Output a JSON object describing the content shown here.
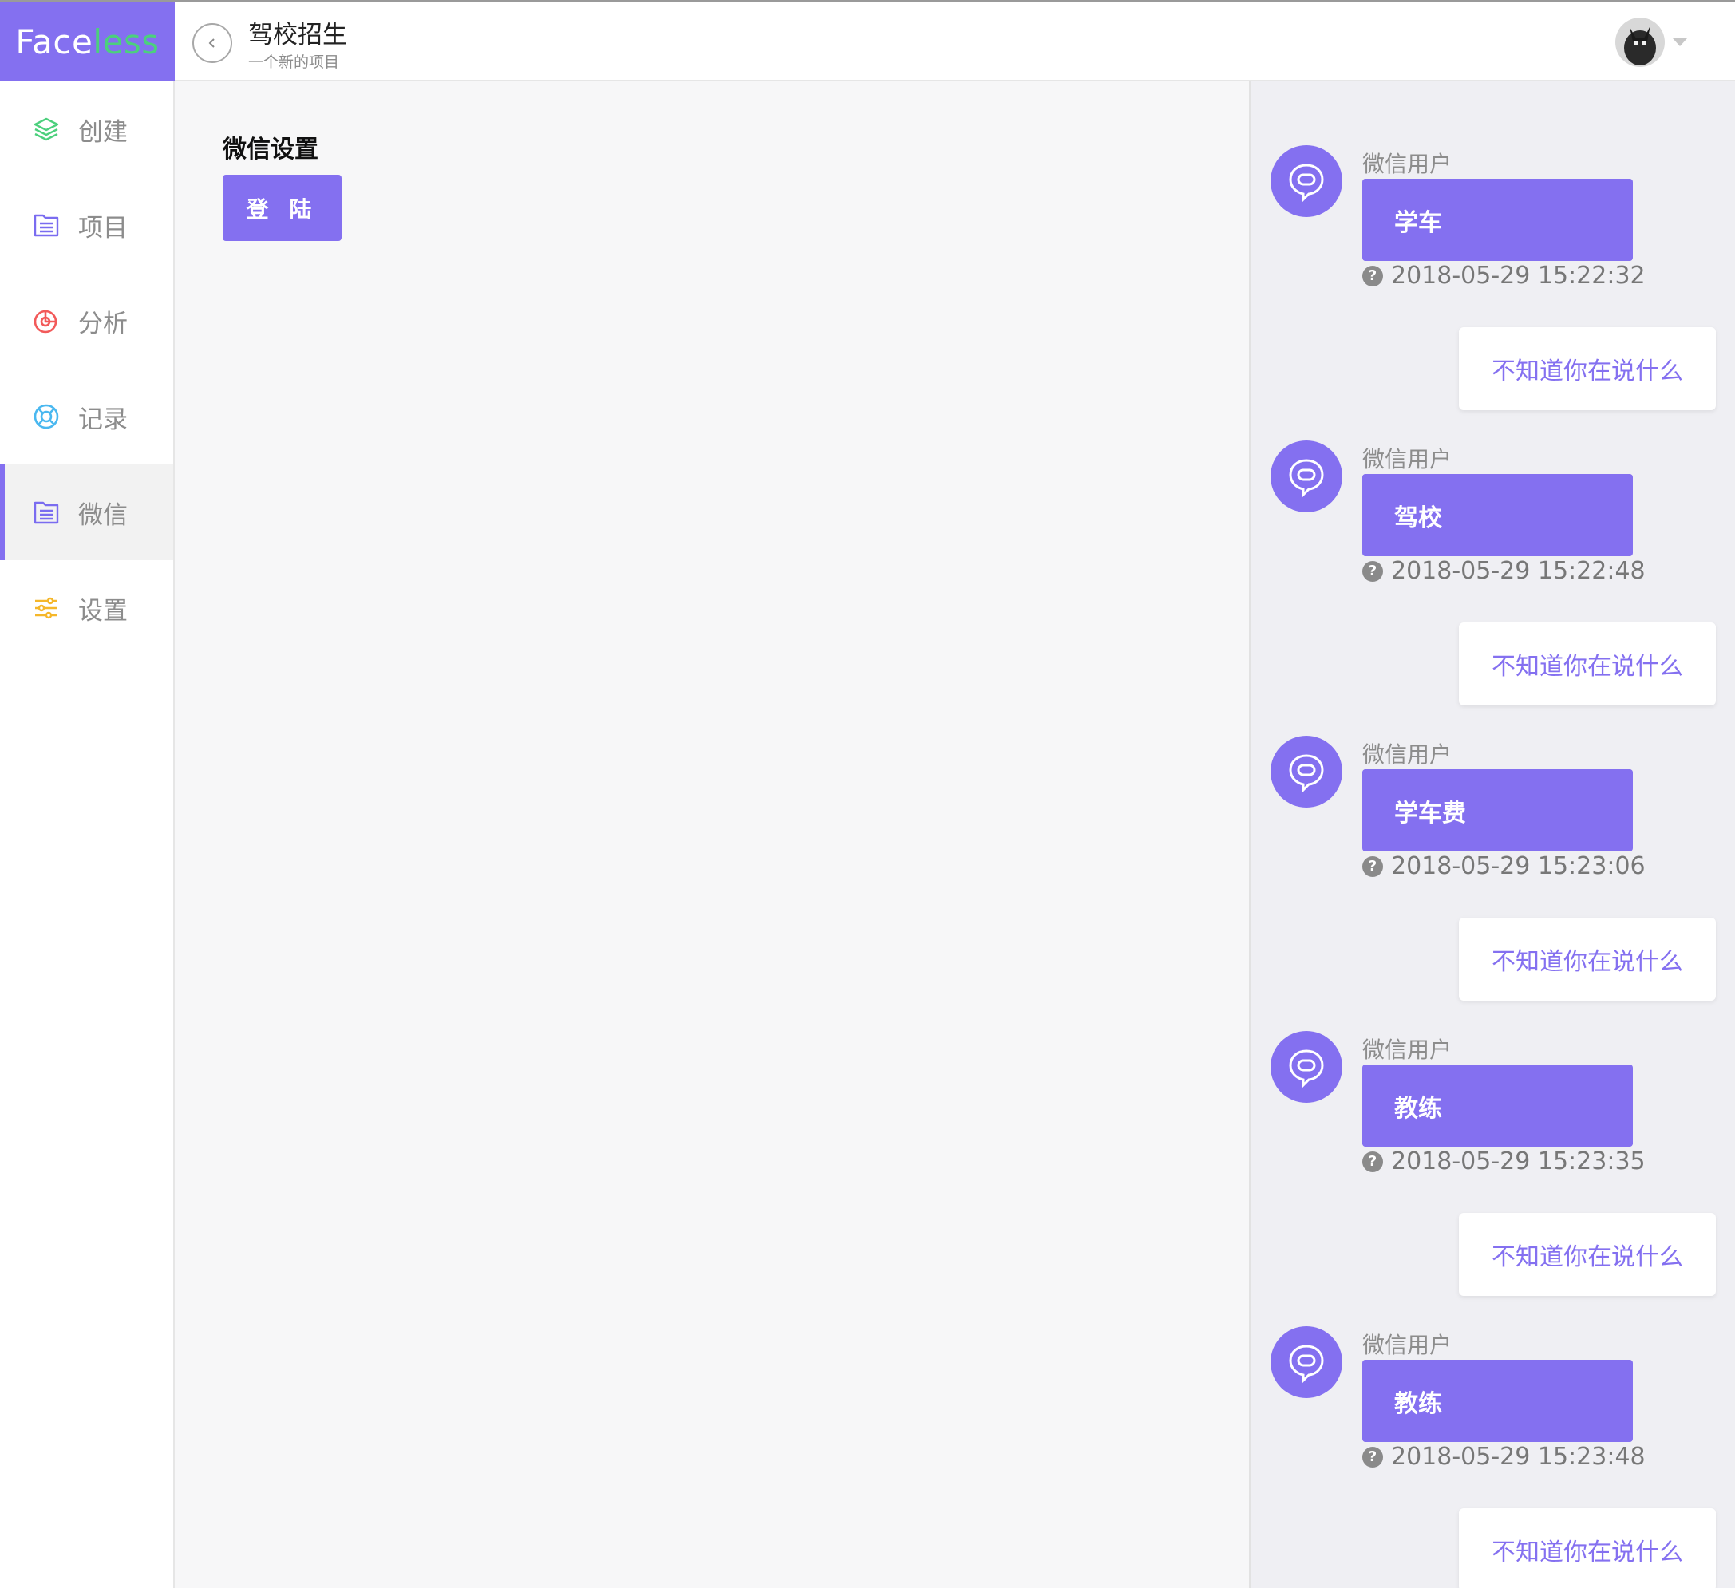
{
  "brand": {
    "prefix": "Face",
    "suffix": "less",
    "accent_color": "#4cd07d",
    "brand_color": "#8470f0"
  },
  "header": {
    "back_icon": "chevron-left-icon",
    "title": "驾校招生",
    "subtitle": "一个新的项目"
  },
  "sidebar": {
    "items": [
      {
        "label": "创建",
        "icon": "layers-icon",
        "color": "#4cd07d",
        "active": false
      },
      {
        "label": "项目",
        "icon": "list-folder-icon",
        "color": "#7a6cf0",
        "active": false
      },
      {
        "label": "分析",
        "icon": "pie-chart-icon",
        "color": "#f25a5a",
        "active": false
      },
      {
        "label": "记录",
        "icon": "lifebuoy-icon",
        "color": "#4ab8f0",
        "active": false
      },
      {
        "label": "微信",
        "icon": "list-folder-icon",
        "color": "#7a6cf0",
        "active": true
      },
      {
        "label": "设置",
        "icon": "sliders-icon",
        "color": "#f5b72a",
        "active": false
      }
    ]
  },
  "main": {
    "section_title": "微信设置",
    "login_button": "登 陆"
  },
  "chat": {
    "messages": [
      {
        "sender": "微信用户",
        "text": "学车",
        "time": "2018-05-29 15:22:32",
        "reply": "不知道你在说什么"
      },
      {
        "sender": "微信用户",
        "text": "驾校",
        "time": "2018-05-29 15:22:48",
        "reply": "不知道你在说什么"
      },
      {
        "sender": "微信用户",
        "text": "学车费",
        "time": "2018-05-29 15:23:06",
        "reply": "不知道你在说什么"
      },
      {
        "sender": "微信用户",
        "text": "教练",
        "time": "2018-05-29 15:23:35",
        "reply": "不知道你在说什么"
      },
      {
        "sender": "微信用户",
        "text": "教练",
        "time": "2018-05-29 15:23:48",
        "reply": "不知道你在说什么"
      }
    ],
    "time_icon": "question-circle-icon",
    "bot_icon": "chat-bubble-icon"
  }
}
